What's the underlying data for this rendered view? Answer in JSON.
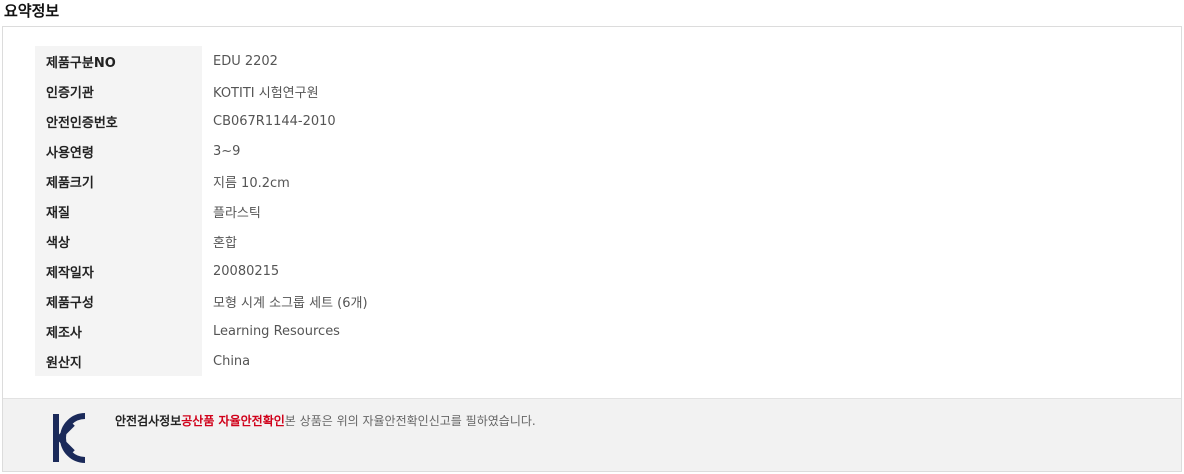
{
  "section_title": "요약정보",
  "spec_rows": [
    {
      "label": "제품구분NO",
      "value": "EDU 2202"
    },
    {
      "label": "인증기관",
      "value": "KOTITI 시험연구원"
    },
    {
      "label": "안전인증번호",
      "value": "CB067R1144-2010"
    },
    {
      "label": "사용연령",
      "value": "3~9"
    },
    {
      "label": "제품크기",
      "value": "지름 10.2cm"
    },
    {
      "label": "재질",
      "value": "플라스틱"
    },
    {
      "label": "색상",
      "value": "혼합"
    },
    {
      "label": "제작일자",
      "value": "20080215"
    },
    {
      "label": "제품구성",
      "value": "모형 시계 소그룹 세트 (6개)"
    },
    {
      "label": "제조사",
      "value": "Learning Resources"
    },
    {
      "label": "원산지",
      "value": "China"
    }
  ],
  "safety": {
    "logo_icon": "kc-certification-mark-icon",
    "label": "안전검사정보",
    "highlight": "공산품 자율안전확인",
    "text": "본 상품은 위의 자율안전확인신고를 필하였습니다.",
    "highlight_color": "#d0021b"
  }
}
